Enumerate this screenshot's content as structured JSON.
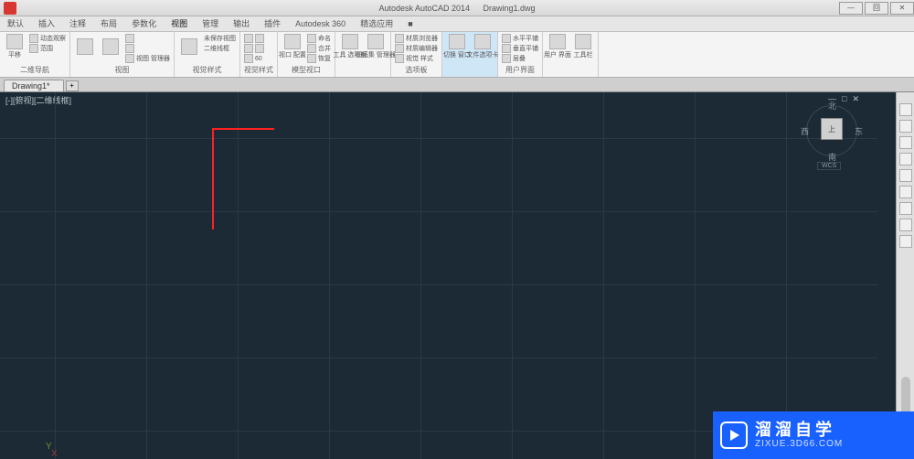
{
  "titlebar": {
    "app_name": "Autodesk AutoCAD 2014",
    "doc_name": "Drawing1.dwg",
    "win_min": "—",
    "win_max": "回",
    "win_close": "✕"
  },
  "menu": {
    "items": [
      "默认",
      "插入",
      "注释",
      "布局",
      "参数化",
      "视图",
      "管理",
      "输出",
      "插件",
      "Autodesk 360",
      "精选应用",
      "■"
    ]
  },
  "ribbon": {
    "panels": [
      {
        "label": "二维导航",
        "big": [
          {
            "label": "平移"
          }
        ],
        "small": [
          "动态观察",
          "范围"
        ]
      },
      {
        "label": "视图",
        "big": [
          {
            "label": "□"
          },
          {
            "label": "□"
          }
        ],
        "small": [
          "回",
          "回",
          "视图 管理器"
        ]
      },
      {
        "label": "视觉样式",
        "big": [
          {
            "label": "□"
          }
        ],
        "small": [
          "未保存视图",
          "二维线框"
        ]
      },
      {
        "label": "视觉样式",
        "small_input": "60",
        "small": []
      },
      {
        "label": "模型视口",
        "big": [
          {
            "label": "视口 配置"
          }
        ],
        "small": [
          "命名",
          "合并",
          "恢复"
        ]
      },
      {
        "label": "",
        "big": [
          {
            "label": "工具 选项板"
          },
          {
            "label": "图纸集 管理器"
          }
        ]
      },
      {
        "label": "选项板",
        "small": [
          "材质浏览器",
          "材质编辑器",
          "视觉 样式"
        ]
      },
      {
        "label": "",
        "big": [
          {
            "label": "切换 窗口"
          },
          {
            "label": "文件选项卡"
          }
        ],
        "hl": true
      },
      {
        "label": "用户界面",
        "small": [
          "水平平铺",
          "垂直平铺",
          "层叠"
        ]
      },
      {
        "label": "",
        "big": [
          {
            "label": "用户 界面"
          },
          {
            "label": "工具栏"
          }
        ]
      }
    ]
  },
  "doctabs": {
    "active": "Drawing1*",
    "plus": "+"
  },
  "canvas": {
    "header": "[-][俯视][二维线框]",
    "ctrl_min": "—",
    "ctrl_max": "□",
    "ctrl_close": "✕",
    "axis_y": "Y",
    "axis_x": "X"
  },
  "viewcube": {
    "face": "上",
    "n": "北",
    "s": "南",
    "w": "西",
    "e": "东",
    "wcs": "WCS"
  },
  "watermark": {
    "cn": "溜溜自学",
    "url": "ZIXUE.3D66.COM"
  }
}
